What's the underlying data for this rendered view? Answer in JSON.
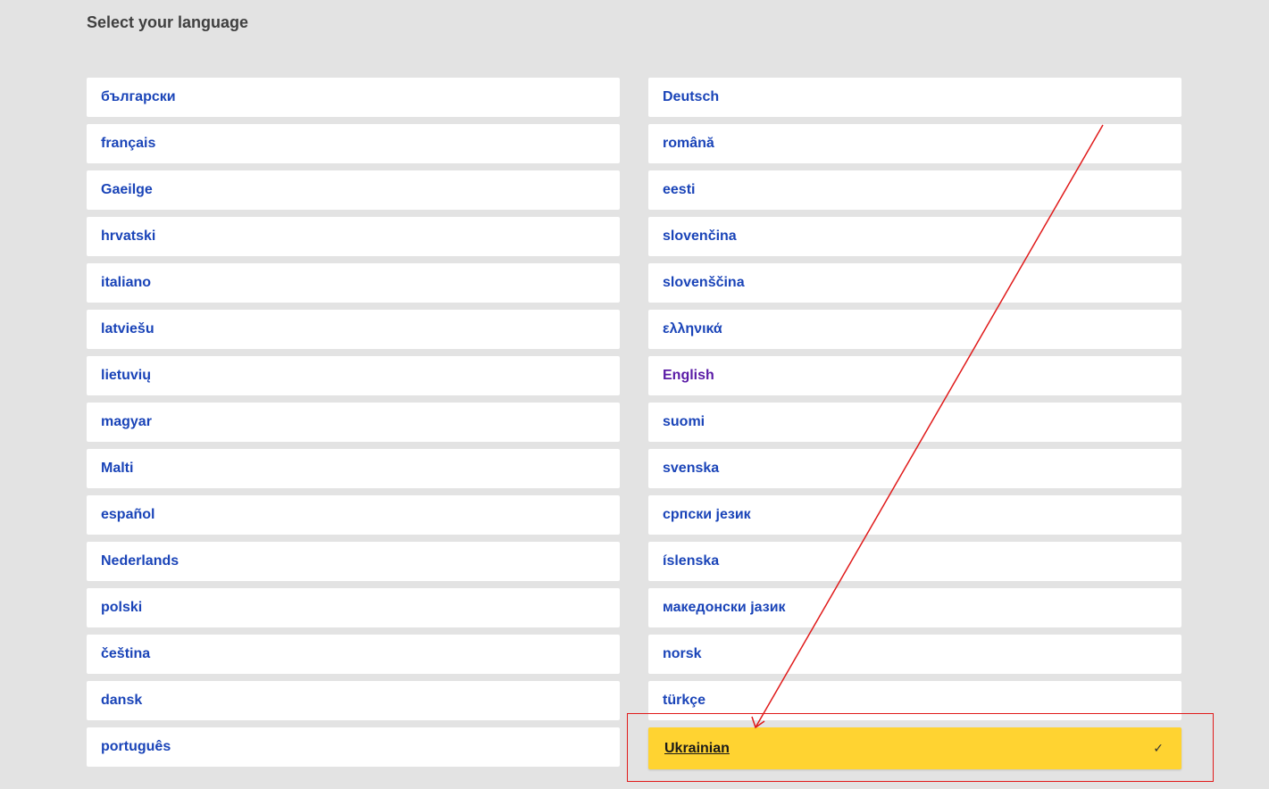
{
  "page": {
    "title": "Select your language"
  },
  "languages_left": [
    {
      "label": "български"
    },
    {
      "label": "français"
    },
    {
      "label": "Gaeilge"
    },
    {
      "label": "hrvatski"
    },
    {
      "label": "italiano"
    },
    {
      "label": "latviešu"
    },
    {
      "label": "lietuvių"
    },
    {
      "label": "magyar"
    },
    {
      "label": "Malti"
    },
    {
      "label": "español"
    },
    {
      "label": "Nederlands"
    },
    {
      "label": "polski"
    },
    {
      "label": "čeština"
    },
    {
      "label": "dansk"
    },
    {
      "label": "português"
    }
  ],
  "languages_right": [
    {
      "label": "Deutsch"
    },
    {
      "label": "română"
    },
    {
      "label": "eesti"
    },
    {
      "label": "slovenčina"
    },
    {
      "label": "slovenščina"
    },
    {
      "label": "ελληνικά"
    },
    {
      "label": "English",
      "state": "visited"
    },
    {
      "label": "suomi"
    },
    {
      "label": "svenska"
    },
    {
      "label": "српски језик"
    },
    {
      "label": "íslenska"
    },
    {
      "label": "македонски јазик"
    },
    {
      "label": "norsk"
    },
    {
      "label": "türkçe"
    },
    {
      "label": "Ukrainian",
      "state": "selected"
    }
  ],
  "selected_indicator": {
    "icon": "checkmark-icon",
    "glyph": "✓"
  },
  "colors": {
    "background": "#e3e3e3",
    "link": "#1a44b8",
    "visited_link": "#5a1ba6",
    "selected_background": "#ffd331",
    "annotation": "#e01a1a"
  }
}
